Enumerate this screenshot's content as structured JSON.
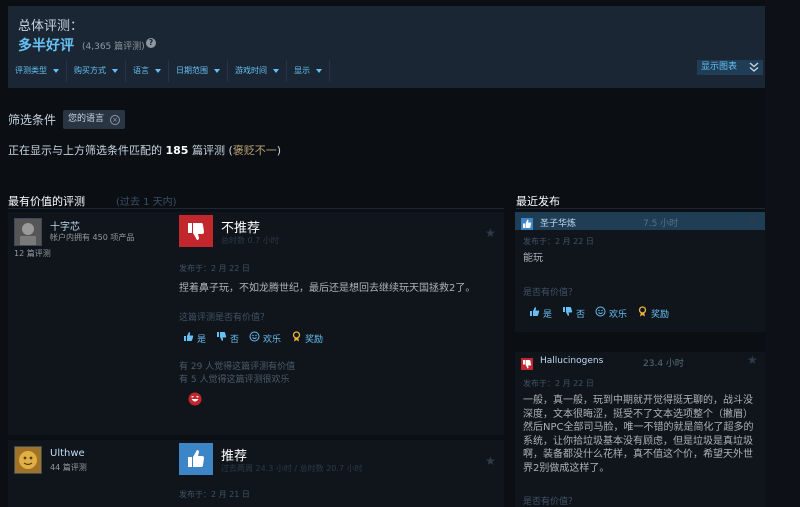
{
  "summary": {
    "label": "总体评测：",
    "score": "多半好评",
    "count": "(4,365 篇评测)",
    "help": "?"
  },
  "filters": [
    {
      "label": "评测类型"
    },
    {
      "label": "购买方式"
    },
    {
      "label": "语言"
    },
    {
      "label": "日期范围"
    },
    {
      "label": "游戏时间"
    },
    {
      "label": "显示"
    }
  ],
  "show_graph": "显示图表",
  "filter_conditions": {
    "label": "筛选条件",
    "chip": "您的语言"
  },
  "showing": {
    "prefix": "正在显示与上方筛选条件匹配的",
    "count": "185",
    "unit": "篇评测 (",
    "mixed": "褒贬不一",
    "suffix": ")"
  },
  "sections": {
    "helpful": "最有价值的评测",
    "helpful_sub": "(过去 1 天内)",
    "recent": "最近发布"
  },
  "reviews": [
    {
      "name": "十字芯",
      "products": "帐户内拥有 450 项产品",
      "reviews": "12 篇评测",
      "verdict": "不推荐",
      "hours": "总时数 0.7 小时",
      "posted": "发布于：2 月 22 日",
      "text": "捏着鼻子玩，不如龙腾世纪，最后还是想回去继续玩天国拯救2了。",
      "helpful_q": "这篇评测是否有价值？",
      "yes": "是",
      "no": "否",
      "funny": "欢乐",
      "award": "奖励",
      "found_helpful": "有 29 人觉得这篇评测有价值",
      "found_funny": "有 5 人觉得这篇评测很欢乐",
      "accent": "#c1272d"
    },
    {
      "name": "Ulthwe",
      "reviews": "44 篇评测",
      "verdict": "推荐",
      "hours": "过去两周 24.3 小时 / 总时数 20.7 小时",
      "posted": "发布于：2 月 21 日",
      "accent": "#3c86c8"
    }
  ],
  "recent": [
    {
      "name": "圣子华炼",
      "hours": "7.5 小时",
      "posted": "发布于：2 月 22 日",
      "text": "能玩",
      "helpful_q": "是否有价值？",
      "yes": "是",
      "no": "否",
      "funny": "欢乐",
      "award": "奖励",
      "accent": "#3c86c8"
    },
    {
      "name": "Hallucinogens",
      "hours": "23.4 小时",
      "posted": "发布于：2 月 22 日",
      "text": "一般，真一般，玩到中期就开觉得挺无聊的，战斗没深度，文本很晦涩，挺受不了文本选项整个（撇眉）然后NPC全部司马脸，唯一不错的就是简化了超多的系统，让你拾垃圾基本没有顾虑，但是垃圾是真垃圾啊，装备都没什么花样，真不值这个价，希望天外世界2别做成这样了。",
      "helpful_q": "是否有价值？",
      "accent": "#c1272d"
    }
  ]
}
